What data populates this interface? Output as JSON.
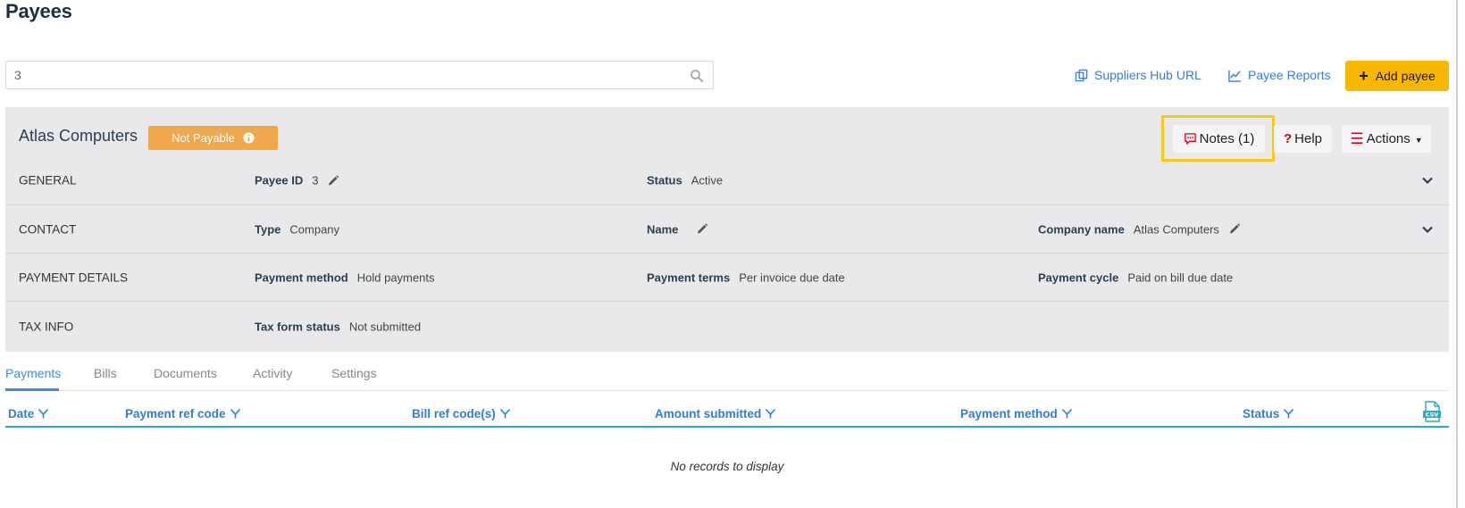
{
  "page": {
    "title": "Payees"
  },
  "search": {
    "value": "3",
    "placeholder": ""
  },
  "top_links": {
    "suppliers_hub": "Suppliers Hub URL",
    "payee_reports": "Payee Reports",
    "add_payee": "Add payee"
  },
  "payee": {
    "name": "Atlas Computers",
    "status_badge": "Not Payable",
    "buttons": {
      "notes": "Notes (1)",
      "help": "Help",
      "actions": "Actions"
    },
    "sections": {
      "general": {
        "label": "GENERAL",
        "payee_id_label": "Payee ID",
        "payee_id_value": "3",
        "status_label": "Status",
        "status_value": "Active"
      },
      "contact": {
        "label": "CONTACT",
        "type_label": "Type",
        "type_value": "Company",
        "name_label": "Name",
        "name_value": "",
        "company_label": "Company name",
        "company_value": "Atlas Computers"
      },
      "payment": {
        "label": "PAYMENT DETAILS",
        "method_label": "Payment method",
        "method_value": "Hold payments",
        "terms_label": "Payment terms",
        "terms_value": "Per invoice due date",
        "cycle_label": "Payment cycle",
        "cycle_value": "Paid on bill due date"
      },
      "tax": {
        "label": "TAX INFO",
        "form_label": "Tax form status",
        "form_value": "Not submitted"
      }
    }
  },
  "tabs": [
    "Payments",
    "Bills",
    "Documents",
    "Activity",
    "Settings"
  ],
  "active_tab": "Payments",
  "grid": {
    "columns": [
      "Date",
      "Payment ref code",
      "Bill ref code(s)",
      "Amount submitted",
      "Payment method",
      "Status"
    ],
    "empty_message": "No records to display",
    "export_icon": "csv-icon"
  },
  "colors": {
    "accent_yellow": "#f9b800",
    "status_orange": "#f0a84a",
    "link_blue": "#3a7bd5",
    "highlight": "#f7c81e",
    "panel_bg": "#e9e9ec"
  }
}
